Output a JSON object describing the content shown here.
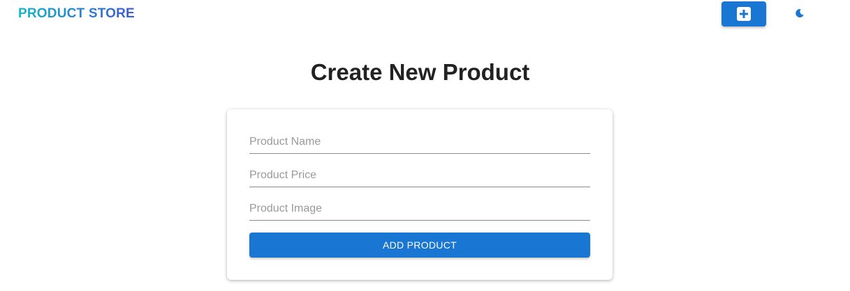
{
  "header": {
    "brand": "PRODUCT STORE",
    "create_button_icon": "plus-square-icon",
    "theme_toggle_icon": "moon-icon",
    "accent_color": "#1976d2"
  },
  "main": {
    "title": "Create New Product"
  },
  "form": {
    "name_placeholder": "Product Name",
    "name_value": "",
    "price_placeholder": "Product Price",
    "price_value": "",
    "image_placeholder": "Product Image",
    "image_value": "",
    "submit_label": "ADD PRODUCT"
  }
}
